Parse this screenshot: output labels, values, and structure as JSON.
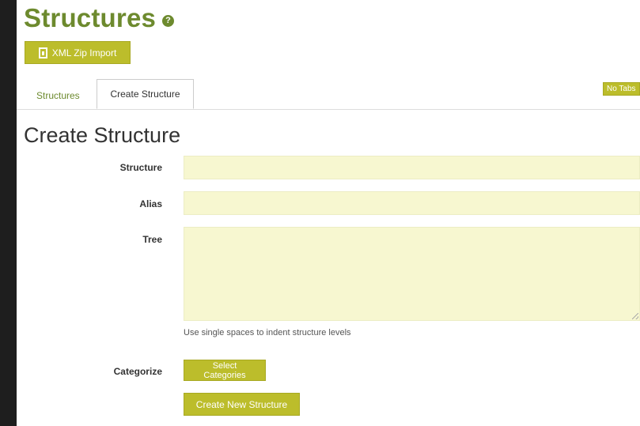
{
  "header": {
    "title": "Structures",
    "help_icon": "?",
    "xml_import_label": "XML Zip Import"
  },
  "tabs": [
    {
      "label": "Structures",
      "active": false
    },
    {
      "label": "Create Structure",
      "active": true
    }
  ],
  "no_tabs_label": "No Tabs",
  "form": {
    "heading": "Create Structure",
    "structure_label": "Structure",
    "structure_value": "",
    "alias_label": "Alias",
    "alias_value": "",
    "tree_label": "Tree",
    "tree_value": "",
    "tree_hint": "Use single spaces to indent structure levels",
    "categorize_label": "Categorize",
    "select_categories_label": "Select Categories",
    "submit_label": "Create New Structure"
  },
  "colors": {
    "title_green": "#6d8a2e",
    "button_olive": "#bcbd2b",
    "field_background": "#f7f7d0"
  },
  "icons": [
    "help-icon",
    "file-icon",
    "resize-grip-icon"
  ]
}
